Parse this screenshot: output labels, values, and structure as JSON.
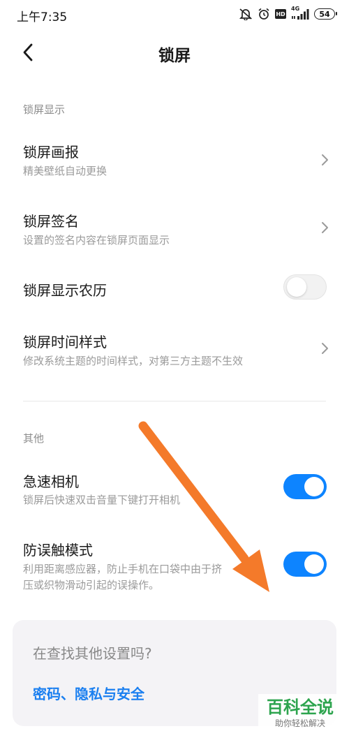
{
  "status_bar": {
    "time": "上午7:35",
    "hd": "HD",
    "network": "4G",
    "battery": "54",
    "icons": [
      "mute-icon",
      "alarm-icon",
      "hd-icon",
      "signal-icon",
      "battery-icon"
    ]
  },
  "header": {
    "title": "锁屏",
    "back_icon": "back-arrow-icon"
  },
  "sections": {
    "lock_display": {
      "header": "锁屏显示",
      "items": [
        {
          "title": "锁屏画报",
          "subtitle": "精美壁纸自动更换",
          "control": "chevron"
        },
        {
          "title": "锁屏签名",
          "subtitle": "设置的签名内容在锁屏页面显示",
          "control": "chevron"
        },
        {
          "title": "锁屏显示农历",
          "control": "toggle",
          "on": false
        },
        {
          "title": "锁屏时间样式",
          "subtitle": "修改系统主题的时间样式，对第三方主题不生效",
          "control": "chevron"
        }
      ]
    },
    "other": {
      "header": "其他",
      "items": [
        {
          "title": "急速相机",
          "subtitle": "锁屏后快速双击音量下键打开相机",
          "control": "toggle",
          "on": true
        },
        {
          "title": "防误触模式",
          "subtitle_line1": "利用距离感应器，防止手机在口袋中由于挤",
          "subtitle_line2": "压或织物滑动引起的误操作。",
          "control": "toggle",
          "on": true
        }
      ]
    }
  },
  "search_card": {
    "question": "在查找其他设置吗?",
    "link": "密码、隐私与安全"
  },
  "overlay": {
    "annotation_icon": "arrow-annotation-icon",
    "arrow_color": "#f47a2a"
  },
  "watermark": {
    "main": "百科全说",
    "sub": "助你轻松解决"
  },
  "colors": {
    "accent": "#0d84ff",
    "link": "#1a7ff0",
    "watermark": "#2da44e"
  }
}
